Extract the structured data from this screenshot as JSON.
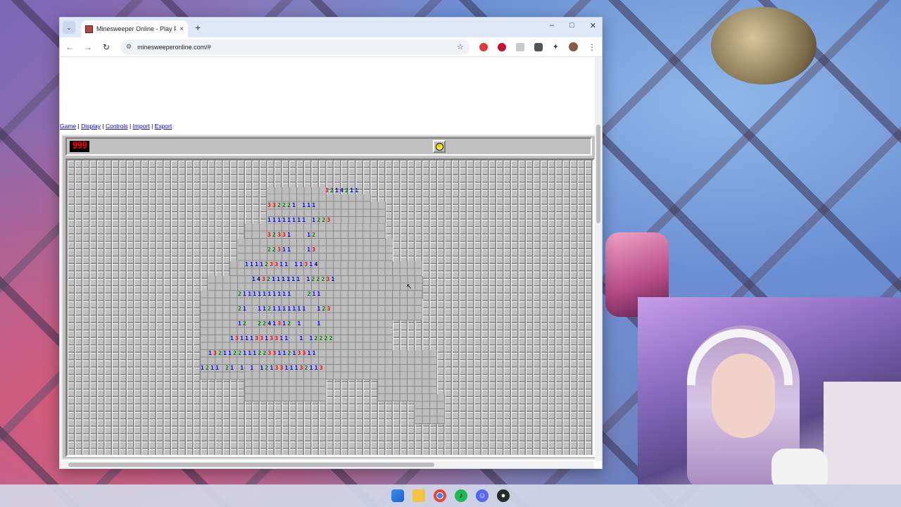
{
  "browser": {
    "tab_title": "Minesweeper Online - Play Free",
    "tab_close": "×",
    "new_tab": "+",
    "tab_menu": "⌄",
    "url": "minesweeperonline.com/#",
    "window_controls": {
      "minimize": "–",
      "maximize": "□",
      "close": "✕"
    },
    "nav": {
      "back": "←",
      "forward": "→",
      "reload": "↻"
    },
    "icons": [
      "site-info-icon",
      "bookmark-star-icon",
      "extension-icon",
      "avatar",
      "kebab-menu-icon"
    ]
  },
  "page": {
    "menu": {
      "game": "Game",
      "display": "Display",
      "controls": "Controls",
      "import": "Import",
      "export": "Export",
      "sep": "|"
    },
    "mine_counter": "999",
    "face": "☺"
  },
  "board": {
    "revealed_rows": [
      {
        "text": "  3214211",
        "left": 0,
        "row": 0
      },
      {
        "text": "332221 111",
        "left": 0,
        "row": 1
      },
      {
        "text": "11111111 1223",
        "left": 0,
        "row": 2
      },
      {
        "text": "32331   12",
        "left": 0,
        "row": 3
      },
      {
        "text": "22311   13",
        "left": 0,
        "row": 4
      },
      {
        "text": "111123311 11314",
        "left": 0,
        "row": 5
      },
      {
        "text": "1432111111 122231",
        "left": 0,
        "row": 6
      },
      {
        "text": "21111111111   211",
        "left": 0,
        "row": 7
      },
      {
        "text": "21  1121111111  123",
        "left": 0,
        "row": 8
      },
      {
        "text": "12  2241312 1   1",
        "left": 0,
        "row": 9
      },
      {
        "text": "131113313311  1 12222",
        "left": 0,
        "row": 10
      },
      {
        "text": "1321122111223311213311",
        "left": 0,
        "row": 11
      },
      {
        "text": "1211 21 1 1 1213311132113",
        "left": 0,
        "row": 12
      }
    ],
    "cursor": "↖"
  },
  "taskbar": {
    "icons": [
      "windows-start-icon",
      "file-explorer-icon",
      "chrome-icon",
      "spotify-icon",
      "discord-icon",
      "obs-icon"
    ],
    "spotify": "♪",
    "discord": "☺",
    "obs": "●"
  },
  "colors": {
    "n1": "#0000ff",
    "n2": "#008000",
    "n3": "#ff0000",
    "n4": "#000080",
    "board_bg": "#c0c0c0"
  }
}
